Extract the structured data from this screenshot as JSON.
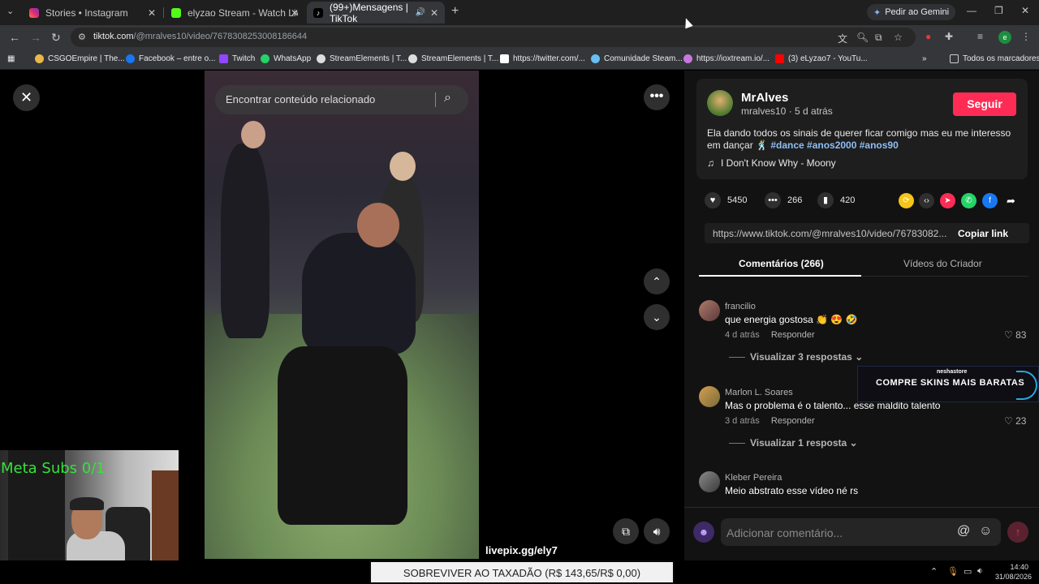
{
  "browser": {
    "tabs": [
      {
        "title": "Stories • Instagram",
        "color": "#e1306c"
      },
      {
        "title": "elyzao Stream - Watch Live on",
        "color": "#53fc18"
      },
      {
        "title": "(99+)Mensagens | TikTok",
        "color": "#ffffff"
      }
    ],
    "gemini_label": "Pedir ao Gemini",
    "url_host": "tiktok.com",
    "url_path": "/@mralves10/video/7678308253008186644",
    "profile_initial": "e",
    "bookmarks": [
      {
        "label": "CSGOEmpire | The...",
        "color": "#e8b84a"
      },
      {
        "label": "Facebook – entre o...",
        "color": "#1877f2"
      },
      {
        "label": "Twitch",
        "color": "#9146ff"
      },
      {
        "label": "WhatsApp",
        "color": "#25d366"
      },
      {
        "label": "StreamElements | T...",
        "color": "#dddddd"
      },
      {
        "label": "StreamElements | T...",
        "color": "#dddddd"
      },
      {
        "label": "https://twitter.com/...",
        "color": "#ffffff"
      },
      {
        "label": "Comunidade Steam...",
        "color": "#66c0f4"
      },
      {
        "label": "https://ioxtream.io/...",
        "color": "#c678dd"
      },
      {
        "label": "(3) eLyzao7 - YouTu...",
        "color": "#ff0000"
      }
    ],
    "all_bookmarks": "Todos os marcadores"
  },
  "video": {
    "search_placeholder": "Encontrar conteúdo relacionado",
    "livepix": "livepix.gg/ely7"
  },
  "webcam": {
    "subs_label": "Meta Subs 0/1"
  },
  "post": {
    "author": "MrAlves",
    "meta": "mralves10 · 5 d atrás",
    "follow_label": "Seguir",
    "caption": "Ela dando todos os sinais de querer ficar comigo mas eu me interesso em dançar 🕺",
    "hashtags": "#dance #anos2000 #anos90",
    "music": "I Don't Know Why - Moony",
    "likes": "5450",
    "comments": "266",
    "saves": "420",
    "link": "https://www.tiktok.com/@mralves10/video/76783082...",
    "copy_label": "Copiar link"
  },
  "panel_tabs": {
    "comments": "Comentários (266)",
    "creator_videos": "Vídeos do Criador"
  },
  "comments": [
    {
      "name": "francilio",
      "text": "que energia gostosa 👏 😍 🤣",
      "time": "4 d atrás",
      "reply": "Responder",
      "likes": "83",
      "more": "Visualizar 3 respostas"
    },
    {
      "name": "Marlon L. Soares",
      "text": "Mas o problema é o talento... esse maldito talento",
      "time": "3 d atrás",
      "reply": "Responder",
      "likes": "23",
      "more": "Visualizar 1 resposta"
    },
    {
      "name": "Kleber Pereira",
      "text": "Meio abstrato esse vídeo né rs",
      "time": "",
      "reply": "",
      "likes": "",
      "more": ""
    }
  ],
  "ad": {
    "brand": "neshastore",
    "text": "COMPRE SKINS MAIS BARATAS"
  },
  "comment_box": {
    "placeholder": "Adicionar comentário..."
  },
  "stream_overlay": {
    "goal": "SOBREVIVER AO TAXADÃO (R$ 143,65/R$ 0,00)"
  },
  "taskbar": {
    "time": "14:40",
    "date": "31/08/2026"
  }
}
